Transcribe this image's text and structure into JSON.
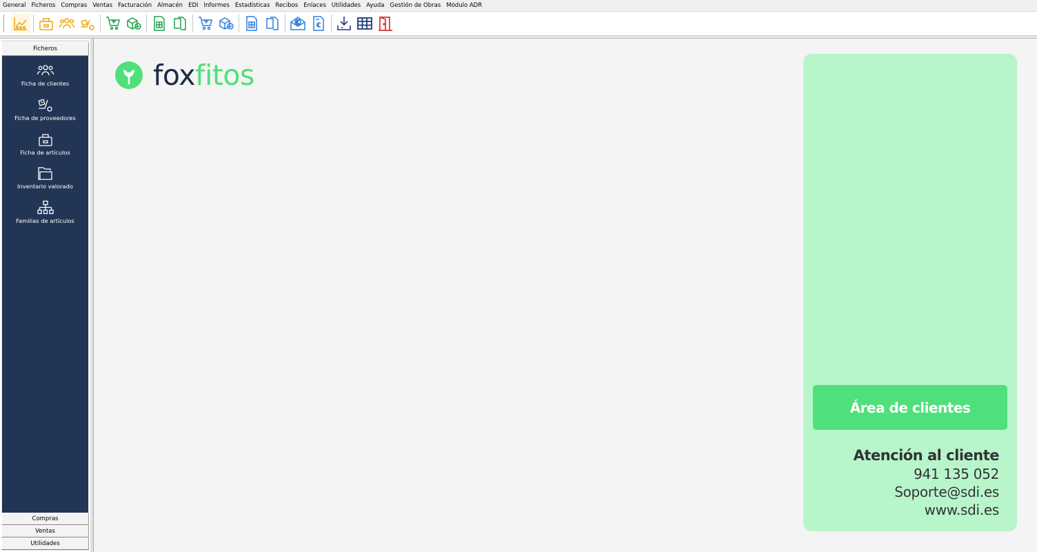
{
  "menu": [
    "General",
    "Ficheros",
    "Compras",
    "Ventas",
    "Facturación",
    "Almacén",
    "EDI",
    "Informes",
    "Estadísticas",
    "Recibos",
    "Enlaces",
    "Utilidades",
    "Ayuda",
    "Gestión de Obras",
    "Módulo ADR"
  ],
  "toolbar": {
    "buttons": [
      {
        "name": "chart-icon",
        "color": "#f0a20a"
      },
      {
        "name": "box-icon",
        "color": "#f0a20a"
      },
      {
        "name": "users-icon",
        "color": "#f0a20a"
      },
      {
        "name": "supplier-icon",
        "color": "#f0a20a"
      },
      {
        "name": "cart-plus-icon",
        "color": "#1aa34a"
      },
      {
        "name": "package-check-icon",
        "color": "#1aa34a"
      },
      {
        "name": "spreadsheet-icon",
        "color": "#1aa34a"
      },
      {
        "name": "copy-icon",
        "color": "#1aa34a"
      },
      {
        "name": "cart-add-icon",
        "color": "#2f7fe0"
      },
      {
        "name": "package-verify-icon",
        "color": "#2f7fe0"
      },
      {
        "name": "invoice-icon",
        "color": "#2f7fe0"
      },
      {
        "name": "documents-icon",
        "color": "#2f7fe0"
      },
      {
        "name": "euro-mail-icon",
        "color": "#2f7fe0"
      },
      {
        "name": "euro-receipt-icon",
        "color": "#2f7fe0"
      },
      {
        "name": "download-icon",
        "color": "#1f3a7a"
      },
      {
        "name": "grid-table-icon",
        "color": "#1f3a7a"
      },
      {
        "name": "exit-door-icon",
        "color": "#d9302c"
      }
    ]
  },
  "sidebar": {
    "header": "Ficheros",
    "items": [
      {
        "label": "Ficha de clientes",
        "icon": "users-icon"
      },
      {
        "label": "Ficha de proveedores",
        "icon": "supplier-icon"
      },
      {
        "label": "Ficha de artículos",
        "icon": "box-icon"
      },
      {
        "label": "Inventario valorado",
        "icon": "folder-icon"
      },
      {
        "label": "Familias de artículos",
        "icon": "hierarchy-icon"
      }
    ],
    "bottom": [
      "Compras",
      "Ventas",
      "Utilidades"
    ]
  },
  "logo": {
    "part1": "fox",
    "part2": "fitos",
    "brand_dark": "#1f2a44",
    "brand_green": "#4fe07b"
  },
  "card": {
    "button_label": "Área de clientes",
    "contact_title": "Atención al cliente",
    "phone": "941 135 052",
    "email": "Soporte@sdi.es",
    "web": "www.sdi.es"
  }
}
